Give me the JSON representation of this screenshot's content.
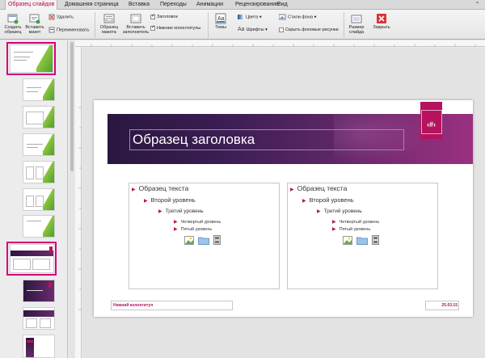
{
  "tabs": [
    {
      "label": "Образец слайдов",
      "active": true
    },
    {
      "label": "Домашняя страница"
    },
    {
      "label": "Вставка"
    },
    {
      "label": "Переходы"
    },
    {
      "label": "Анимации"
    },
    {
      "label": "Рецензирование"
    },
    {
      "label": "Вид"
    }
  ],
  "ribbon": {
    "create_line1": "Создать",
    "create_line2": "образец",
    "insert_layout_line1": "Вставить",
    "insert_layout_line2": "макет",
    "delete": "Удалить",
    "rename": "Переименовать",
    "master_layout_line1": "Образец",
    "master_layout_line2": "макета",
    "insert_placeholder_line1": "Вставить",
    "insert_placeholder_line2": "заполнитель",
    "title_cb": "Заголовок",
    "footers_cb": "Нижние колонтитулы",
    "themes": "Темы",
    "colors": "Цвета",
    "fonts": "Шрифты",
    "bg_styles": "Стили фона",
    "hide_bg": "Скрыть фоновые рисунки",
    "slide_size_line1": "Размер",
    "slide_size_line2": "слайда",
    "close": "Закрыть",
    "accent_color": "#b8004f",
    "close_color": "#e03030"
  },
  "slide": {
    "title": "Образец заголовка",
    "slide_number": "‹#›",
    "levels": [
      "Образец текста",
      "Второй уровень",
      "Третий уровень",
      "Четвертый уровень",
      "Пятый уровень"
    ],
    "footer": "Нижний колонтитул",
    "date": "25.03.15",
    "accent": "#b5135e"
  }
}
